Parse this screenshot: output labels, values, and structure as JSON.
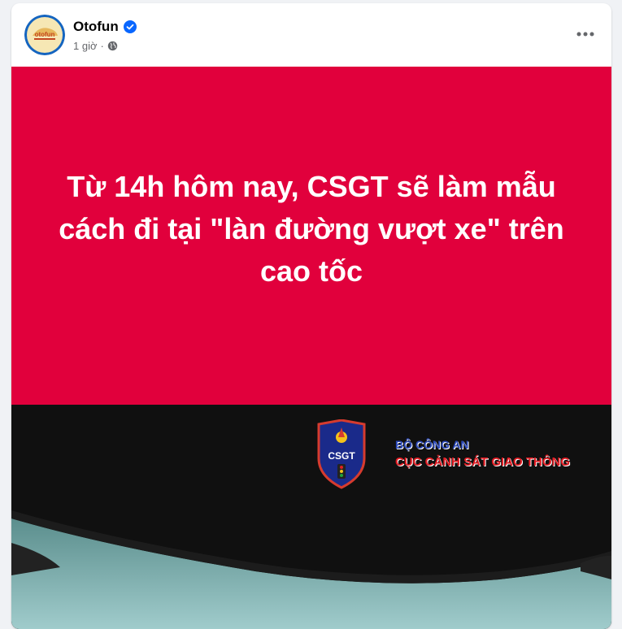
{
  "post": {
    "page_name": "Otofun",
    "time": "1 giờ",
    "separator": "·",
    "avatar_logo_text": "otofun",
    "more_label": "•••"
  },
  "media": {
    "headline": "Từ 14h hôm nay, CSGT sẽ làm mẫu cách đi tại \"làn đường vượt xe\" trên cao tốc",
    "video": {
      "badge_text": "CSGT",
      "agency_line1": "BỘ CÔNG AN",
      "agency_line2": "CỤC CẢNH SÁT GIAO THÔNG"
    }
  },
  "colors": {
    "banner": "#e1003c",
    "verified": "#0866ff",
    "agency_blue": "#2b49b8",
    "agency_red": "#e11b22"
  }
}
